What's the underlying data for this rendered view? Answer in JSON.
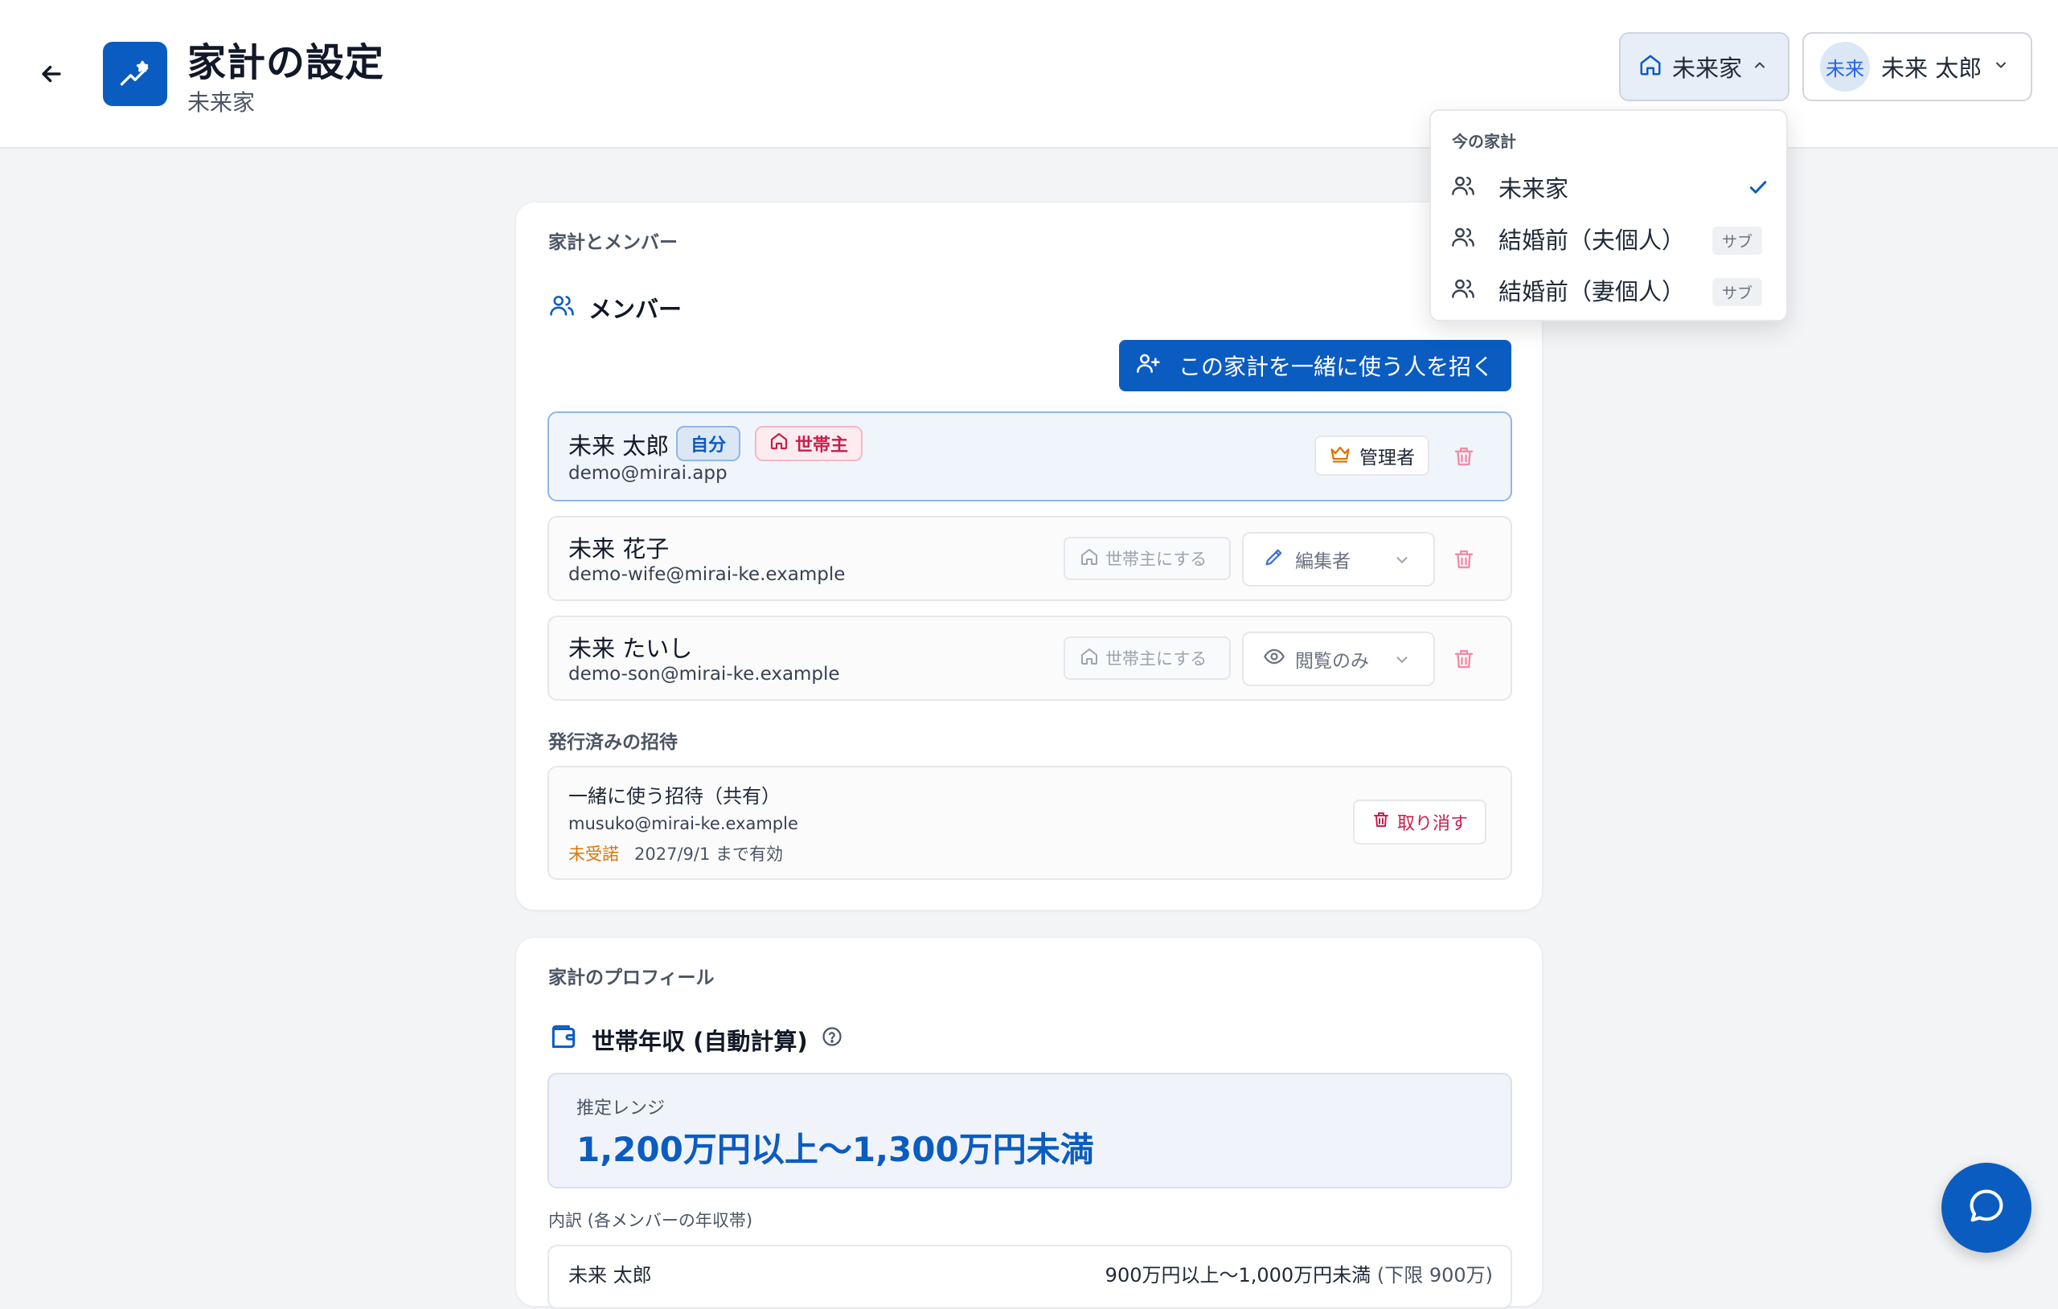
{
  "header": {
    "title": "家計の設定",
    "subtitle": "未来家",
    "household_switcher": "未来家",
    "user_avatar": "未来",
    "user_name": "未来 太郎"
  },
  "dropdown": {
    "title": "今の家計",
    "items": [
      {
        "label": "未来家",
        "selected": true
      },
      {
        "label": "結婚前（夫個人）",
        "badge": "サブ"
      },
      {
        "label": "結婚前（妻個人）",
        "badge": "サブ"
      }
    ]
  },
  "members_card": {
    "section_label": "家計とメンバー",
    "heading": "メンバー",
    "invite_button": "この家計を一緒に使う人を招く",
    "members": [
      {
        "name": "未来 太郎",
        "email": "demo@mirai.app",
        "badge_self": "自分",
        "badge_head": "世帯主",
        "role": "管理者"
      },
      {
        "name": "未来 花子",
        "email": "demo-wife@mirai-ke.example",
        "make_head": "世帯主にする",
        "role": "編集者"
      },
      {
        "name": "未来 たいし",
        "email": "demo-son@mirai-ke.example",
        "make_head": "世帯主にする",
        "role": "閲覧のみ"
      }
    ],
    "invites_label": "発行済みの招待",
    "invite": {
      "title": "一緒に使う招待（共有）",
      "email": "musuko@mirai-ke.example",
      "status": "未受諾",
      "expiry": "2027/9/1 まで有効",
      "revoke": "取り消す"
    }
  },
  "profile_card": {
    "section_label": "家計のプロフィール",
    "heading": "世帯年収 (自動計算)",
    "range_label": "推定レンジ",
    "range_value": "1,200万円以上〜1,300万円未満",
    "breakdown_label": "内訳 (各メンバーの年収帯)",
    "breakdown": [
      {
        "name": "未来 太郎",
        "value": "900万円以上〜1,000万円未満",
        "limit": "(下限 900万)"
      }
    ]
  },
  "colors": {
    "primary": "#0b5cc0",
    "danger": "#c81e4b",
    "warning": "#d97706"
  }
}
